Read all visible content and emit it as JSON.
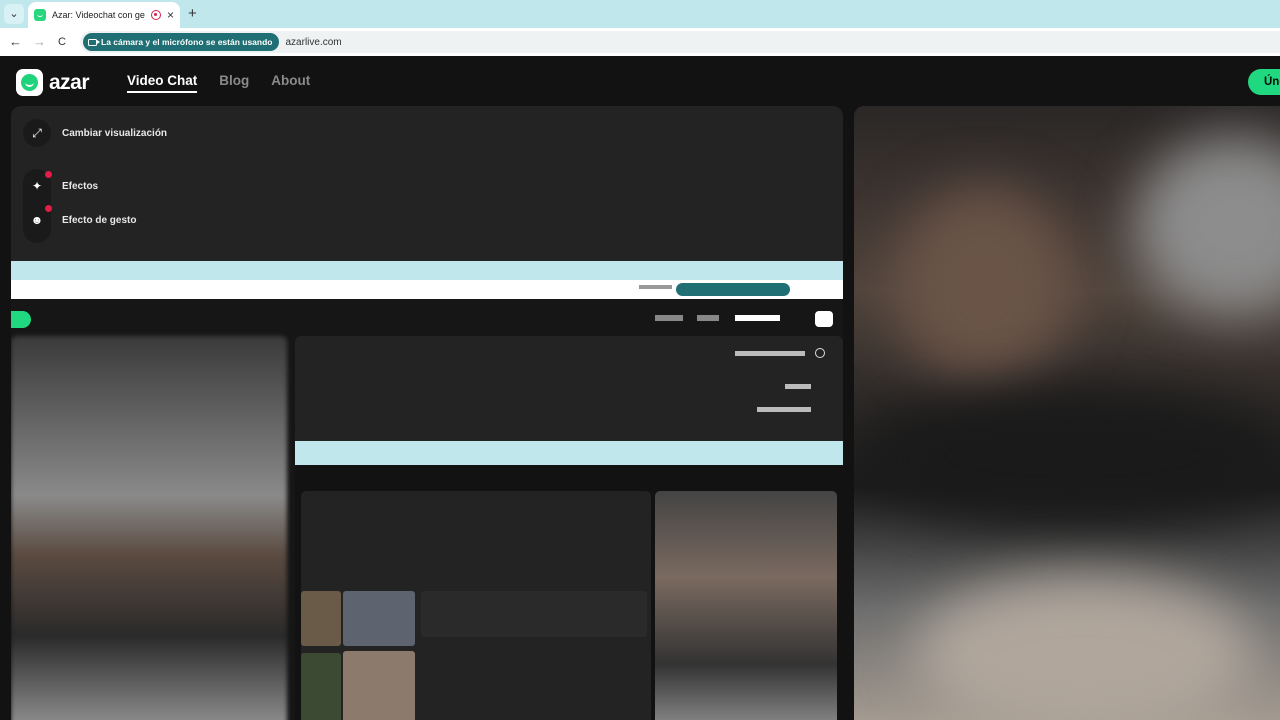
{
  "browser": {
    "tab_title": "Azar: Videochat con gente",
    "new_tab": "+",
    "close_tab": "×",
    "back": "←",
    "forward": "→",
    "reload": "C",
    "camera_notice": "La cámara y el micrófono se están usando",
    "url": "azarlive.com"
  },
  "site": {
    "logo_text": "azar",
    "nav": [
      "Video Chat",
      "Blog",
      "About"
    ],
    "join_label": "Úne"
  },
  "controls": {
    "change_view": "Cambiar visualización",
    "effects": "Efectos",
    "gesture_effect": "Efecto de gesto"
  },
  "colors": {
    "brand_green": "#1fd87f",
    "tab_bar": "#bfe7ec",
    "notice_pill": "#1f6f74",
    "notification_dot": "#e11d48"
  }
}
